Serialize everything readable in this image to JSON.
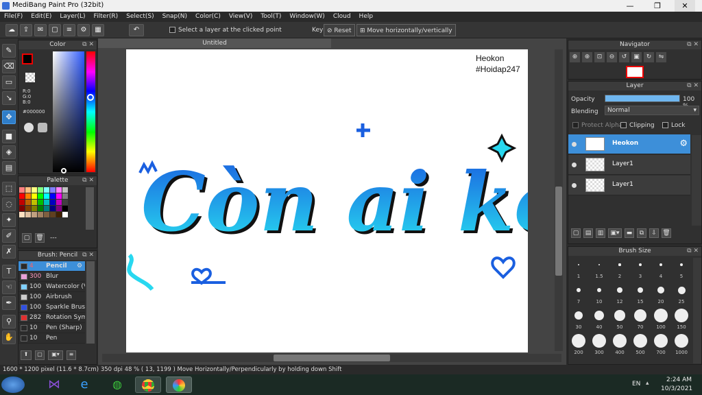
{
  "window": {
    "title": "MediBang Paint Pro (32bit)",
    "min": "—",
    "max": "❐",
    "close": "✕"
  },
  "menu": [
    "File(F)",
    "Edit(E)",
    "Layer(L)",
    "Filter(R)",
    "Select(S)",
    "Snap(N)",
    "Color(C)",
    "View(V)",
    "Tool(T)",
    "Window(W)",
    "Cloud",
    "Help"
  ],
  "toolbar": {
    "select_layer_label": "Select a layer at the clicked point",
    "key_label": "Key",
    "reset_label": "Reset",
    "move_label": "Move horizontally/vertically",
    "undo_icon": "undo-icon"
  },
  "color_panel": {
    "title": "Color",
    "r": "R:0",
    "g": "G:0",
    "b": "B:0",
    "hex": "#000000"
  },
  "palette_panel": {
    "title": "Palette",
    "more": "---"
  },
  "brush_panel": {
    "title": "Brush: Pencil",
    "items": [
      {
        "size": "4",
        "name": "Pencil",
        "color": "#2a2a2a"
      },
      {
        "size": "300",
        "name": "Blur",
        "color": "#e8a0d8"
      },
      {
        "size": "100",
        "name": "Watercolor (V",
        "color": "#80d0ff"
      },
      {
        "size": "100",
        "name": "Airbrush",
        "color": "#cccccc"
      },
      {
        "size": "100",
        "name": "Sparkle Brush",
        "color": "#3050e0"
      },
      {
        "size": "282",
        "name": "Rotation Sym",
        "color": "#e03030"
      },
      {
        "size": "10",
        "name": "Pen (Sharp)",
        "color": "#2a2a2a"
      },
      {
        "size": "10",
        "name": "Pen",
        "color": "#2a2a2a"
      }
    ]
  },
  "document": {
    "tab": "Untitled",
    "watermark_line1": "Heokon",
    "watermark_line2": "#Hoidap247",
    "art_text": "Còn ai ko?"
  },
  "navigator": {
    "title": "Navigator"
  },
  "layer_panel": {
    "title": "Layer",
    "opacity_label": "Opacity",
    "opacity_value": "100 %",
    "opacity": 1.0,
    "blending_label": "Blending",
    "blending_value": "Normal",
    "protect_alpha": "Protect Alpha",
    "clipping": "Clipping",
    "lock": "Lock",
    "layers": [
      {
        "name": "Heokon",
        "selected": true
      },
      {
        "name": "Layer1",
        "selected": false
      },
      {
        "name": "Layer1",
        "selected": false
      }
    ]
  },
  "brush_size_panel": {
    "title": "Brush Size",
    "sizes": [
      "1",
      "1.5",
      "2",
      "3",
      "4",
      "5",
      "7",
      "10",
      "12",
      "15",
      "20",
      "25",
      "30",
      "40",
      "50",
      "70",
      "100",
      "150",
      "200",
      "300",
      "400",
      "500",
      "700",
      "1000"
    ]
  },
  "status": {
    "text": "1600 * 1200 pixel   (11.6 * 8.7cm)   350 dpi   48 %   ( 13, 1199 )   Move Horizontally/Perpendicularly by holding down Shift"
  },
  "taskbar": {
    "lang": "EN",
    "time": "2:24 AM",
    "date": "10/3/2021"
  },
  "colors": {
    "accent": "#3d8fd9",
    "art_blue": "#1a5fe0",
    "art_cyan": "#28d8f0"
  }
}
